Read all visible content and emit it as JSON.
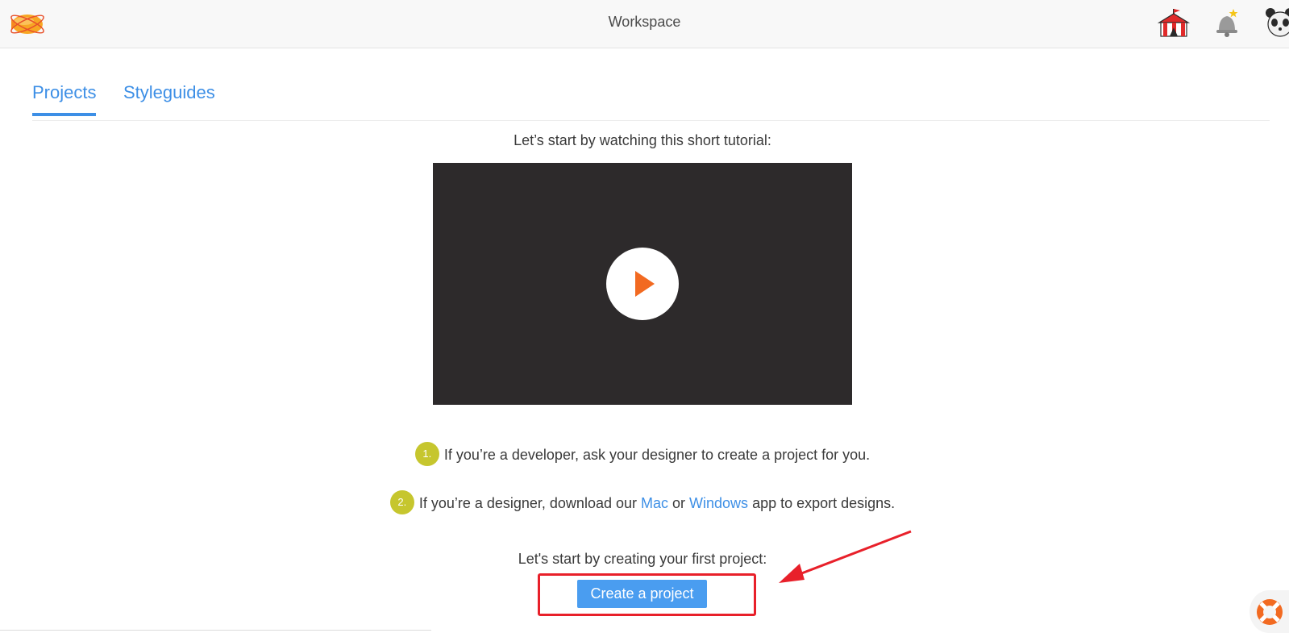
{
  "header": {
    "title": "Workspace",
    "logo_icon": "zeplin-blimp-icon",
    "icons": [
      "circus-tent-icon",
      "notification-bell-icon",
      "panda-avatar-icon"
    ]
  },
  "tabs": [
    {
      "label": "Projects",
      "active": true
    },
    {
      "label": "Styleguides",
      "active": false
    }
  ],
  "main": {
    "tutorial_intro": "Let’s start by watching this short tutorial:",
    "video": {
      "play_icon": "play-icon"
    },
    "steps": {
      "one": {
        "badge": "1.",
        "text": "If you’re a developer, ask your designer to create a project for you."
      },
      "two": {
        "badge": "2.",
        "prefix": "If you’re a designer, download our ",
        "mac_link": "Mac",
        "or_text": " or ",
        "windows_link": "Windows",
        "suffix": " app to export designs."
      }
    },
    "cta_heading": "Let's start by creating your first project:",
    "create_button": "Create a project"
  },
  "annotation": {
    "highlight_color": "#e8202a",
    "arrow_color": "#e8202a"
  },
  "help": {
    "icon": "lifebuoy-icon"
  },
  "colors": {
    "accent": "#3d8fe6",
    "button": "#4a9df0",
    "badge": "#c6c62e",
    "video_bg": "#2d2a2b",
    "play": "#f26a21"
  }
}
